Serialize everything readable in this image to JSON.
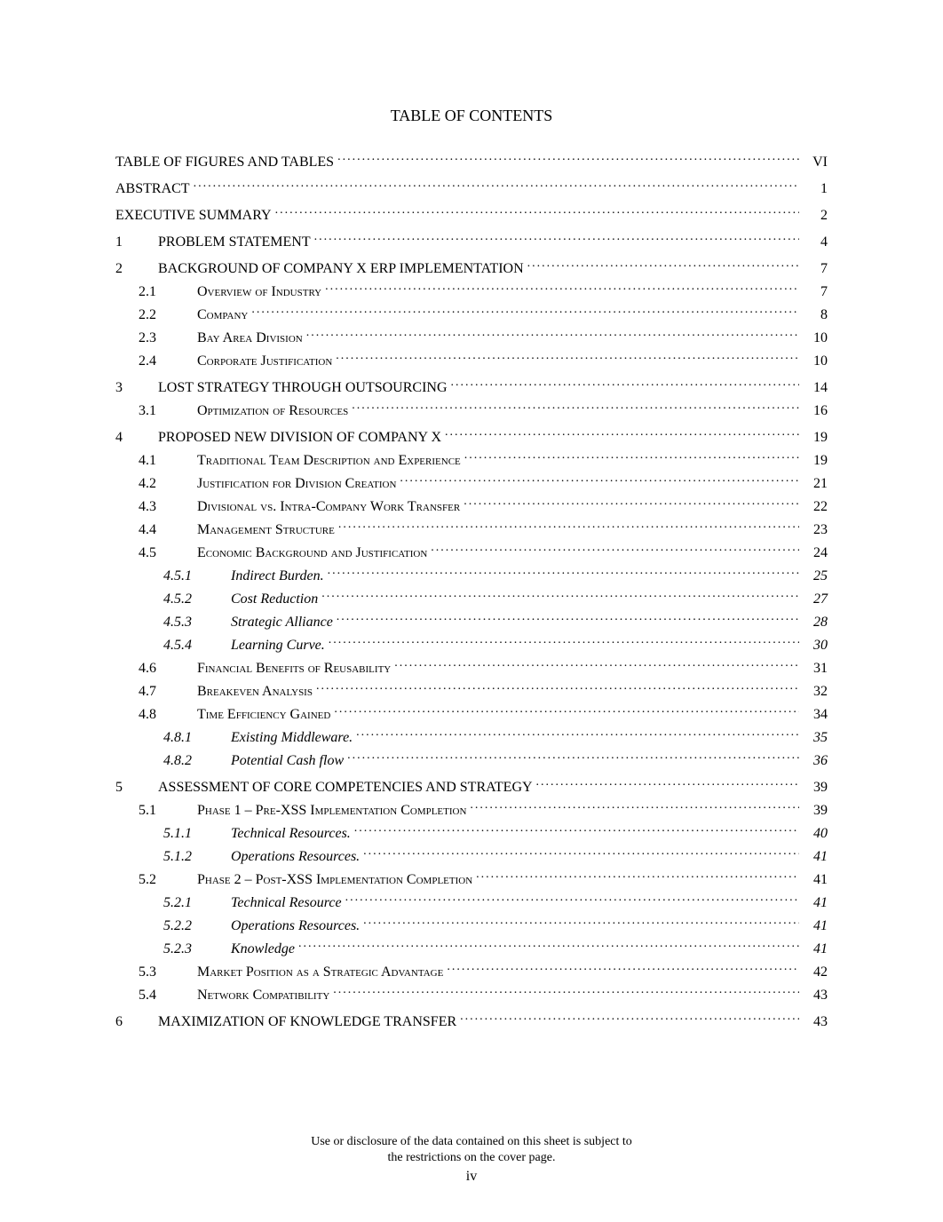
{
  "heading": "TABLE OF CONTENTS",
  "entries": [
    {
      "level": 0,
      "num": "",
      "title": "TABLE OF FIGURES AND TABLES",
      "page": "VI",
      "style": "upper"
    },
    {
      "level": 0,
      "num": "",
      "title": "ABSTRACT",
      "page": "1",
      "style": "upper"
    },
    {
      "level": 0,
      "num": "",
      "title": "EXECUTIVE SUMMARY",
      "page": "2",
      "style": "upper"
    },
    {
      "level": 1,
      "num": "1",
      "title": "PROBLEM STATEMENT",
      "page": "4",
      "style": "upper"
    },
    {
      "level": 1,
      "num": "2",
      "title": "BACKGROUND OF COMPANY X ERP IMPLEMENTATION",
      "page": "7",
      "style": "upper"
    },
    {
      "level": 2,
      "num": "2.1",
      "title": "Overview of Industry",
      "page": "7",
      "style": "smallcaps"
    },
    {
      "level": 2,
      "num": "2.2",
      "title": "Company",
      "page": "8",
      "style": "smallcaps"
    },
    {
      "level": 2,
      "num": "2.3",
      "title": "Bay Area Division",
      "page": "10",
      "style": "smallcaps"
    },
    {
      "level": 2,
      "num": "2.4",
      "title": "Corporate Justification",
      "page": "10",
      "style": "smallcaps"
    },
    {
      "level": 1,
      "num": "3",
      "title": "LOST STRATEGY THROUGH OUTSOURCING",
      "page": "14",
      "style": "upper"
    },
    {
      "level": 2,
      "num": "3.1",
      "title": "Optimization of Resources",
      "page": "16",
      "style": "smallcaps"
    },
    {
      "level": 1,
      "num": "4",
      "title": "PROPOSED NEW DIVISION OF COMPANY X",
      "page": "19",
      "style": "upper"
    },
    {
      "level": 2,
      "num": "4.1",
      "title": "Traditional Team Description and Experience",
      "page": "19",
      "style": "smallcaps"
    },
    {
      "level": 2,
      "num": "4.2",
      "title": "Justification for Division Creation",
      "page": "21",
      "style": "smallcaps"
    },
    {
      "level": 2,
      "num": "4.3",
      "title": "Divisional vs. Intra-Company Work Transfer",
      "page": "22",
      "style": "smallcaps"
    },
    {
      "level": 2,
      "num": "4.4",
      "title": "Management Structure",
      "page": "23",
      "style": "smallcaps"
    },
    {
      "level": 2,
      "num": "4.5",
      "title": "Economic Background and Justification",
      "page": "24",
      "style": "smallcaps"
    },
    {
      "level": 3,
      "num": "4.5.1",
      "title": "Indirect Burden.",
      "page": "25",
      "style": "italic"
    },
    {
      "level": 3,
      "num": "4.5.2",
      "title": "Cost Reduction",
      "page": "27",
      "style": "italic"
    },
    {
      "level": 3,
      "num": "4.5.3",
      "title": "Strategic Alliance",
      "page": "28",
      "style": "italic"
    },
    {
      "level": 3,
      "num": "4.5.4",
      "title": "Learning Curve.",
      "page": "30",
      "style": "italic"
    },
    {
      "level": 2,
      "num": "4.6",
      "title": "Financial Benefits of Reusability",
      "page": "31",
      "style": "smallcaps"
    },
    {
      "level": 2,
      "num": "4.7",
      "title": "Breakeven Analysis",
      "page": "32",
      "style": "smallcaps"
    },
    {
      "level": 2,
      "num": "4.8",
      "title": "Time Efficiency Gained",
      "page": "34",
      "style": "smallcaps"
    },
    {
      "level": 3,
      "num": "4.8.1",
      "title": "Existing Middleware.",
      "page": "35",
      "style": "italic"
    },
    {
      "level": 3,
      "num": "4.8.2",
      "title": "Potential Cash flow",
      "page": "36",
      "style": "italic"
    },
    {
      "level": 1,
      "num": "5",
      "title": "ASSESSMENT OF CORE COMPETENCIES AND STRATEGY",
      "page": "39",
      "style": "upper"
    },
    {
      "level": 2,
      "num": "5.1",
      "title": "Phase 1 – Pre-XSS Implementation Completion",
      "page": "39",
      "style": "smallcaps"
    },
    {
      "level": 3,
      "num": "5.1.1",
      "title": "Technical Resources.",
      "page": "40",
      "style": "italic"
    },
    {
      "level": 3,
      "num": "5.1.2",
      "title": "Operations Resources.",
      "page": "41",
      "style": "italic"
    },
    {
      "level": 2,
      "num": "5.2",
      "title": "Phase 2 – Post-XSS Implementation Completion",
      "page": "41",
      "style": "smallcaps"
    },
    {
      "level": 3,
      "num": "5.2.1",
      "title": "Technical Resource",
      "page": "41",
      "style": "italic"
    },
    {
      "level": 3,
      "num": "5.2.2",
      "title": "Operations Resources.",
      "page": "41",
      "style": "italic"
    },
    {
      "level": 3,
      "num": "5.2.3",
      "title": "Knowledge",
      "page": "41",
      "style": "italic"
    },
    {
      "level": 2,
      "num": "5.3",
      "title": "Market Position as a Strategic Advantage",
      "page": "42",
      "style": "smallcaps"
    },
    {
      "level": 2,
      "num": "5.4",
      "title": "Network Compatibility",
      "page": "43",
      "style": "smallcaps"
    },
    {
      "level": 1,
      "num": "6",
      "title": "MAXIMIZATION OF KNOWLEDGE TRANSFER",
      "page": "43",
      "style": "upper"
    }
  ],
  "footer": {
    "line1": "Use or disclosure of the data contained on this sheet is subject to",
    "line2": "the restrictions on the cover page.",
    "pagenum": "iv"
  }
}
